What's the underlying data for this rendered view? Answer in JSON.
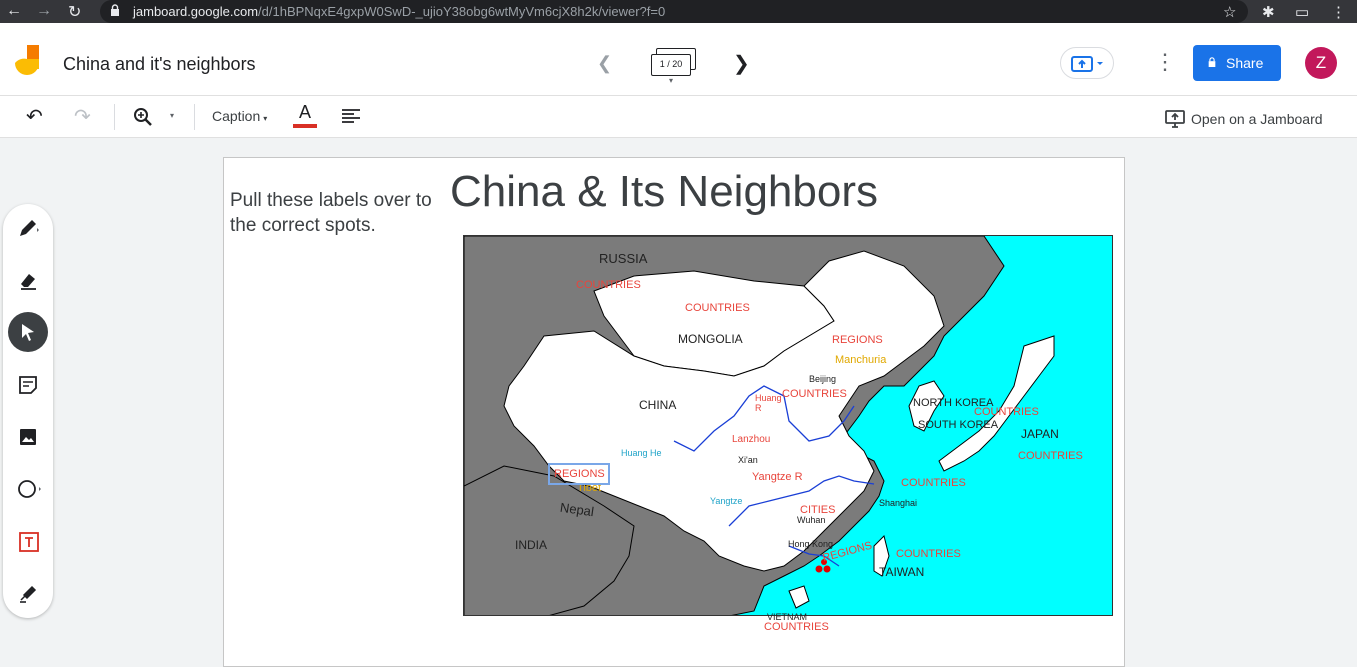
{
  "browser": {
    "url_host": "jamboard.google.com",
    "url_path": "/d/1hBPNqxE4gxpW0SwD-_ujioY38obg6wtMyVm6cjX8h2k/viewer?f=0"
  },
  "header": {
    "doc_title": "China and it's neighbors",
    "frame_counter": "1 / 20",
    "share_label": "Share",
    "avatar_initial": "Z"
  },
  "toolbar": {
    "text_style": "Caption",
    "open_on_jamboard": "Open on a Jamboard"
  },
  "slide": {
    "instructions": "Pull these labels over to the correct spots.",
    "title": "China & Its Neighbors",
    "map_labels": {
      "russia": "RUSSIA",
      "mongolia": "MONGOLIA",
      "china": "CHINA",
      "india": "INDIA",
      "nepal": "Nepal",
      "north_korea": "NORTH KOREA",
      "south_korea": "SOUTH KOREA",
      "japan": "JAPAN",
      "taiwan": "TAIWAN",
      "vietnam": "VIETNAM",
      "beijing": "Beijing",
      "lanzhou": "Lanzhou",
      "xian": "Xi'an",
      "wuhan": "Wuhan",
      "shanghai": "Shanghai",
      "hong_kong": "Hong Kong",
      "huang_r": "Huang R",
      "huang_he": "Huang He",
      "yangtze_r": "Yangtze R",
      "yangtze": "Yangtze",
      "manchuria": "Manchuria",
      "tibet": "Tibet"
    },
    "drag_labels": {
      "countries": "COUNTRIES",
      "regions": "REGIONS",
      "cities": "CITIES"
    }
  },
  "colors": {
    "share": "#1a73e8",
    "avatar": "#c2185b",
    "water": "#00ffff",
    "land_other": "#7b7b7b",
    "label_red": "#e8453c",
    "label_gold": "#e0a800",
    "river_blue": "#1a3fd6"
  }
}
